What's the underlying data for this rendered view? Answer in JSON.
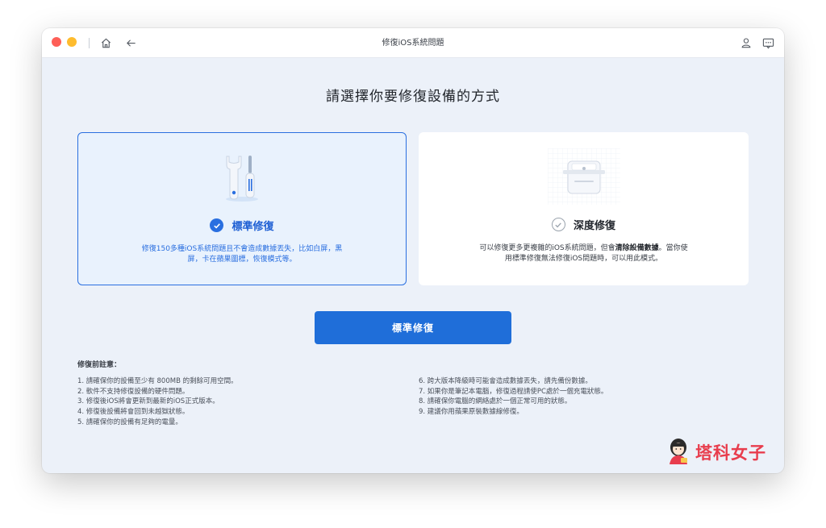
{
  "window": {
    "title": "修復iOS系統問題"
  },
  "heading": "請選擇你要修復設備的方式",
  "cards": {
    "standard": {
      "title": "標準修復",
      "desc_line1": "修復150多種iOS系統問題且不會造成數據丟失，比如白屏，黑",
      "desc_line2": "屏，卡在蘋果圖標，恢復模式等。",
      "selected": true
    },
    "deep": {
      "title": "深度修復",
      "desc_pre": "可以修復更多更複雜的iOS系統問題，但會",
      "desc_bold": "清除設備數據",
      "desc_post": "。當你使",
      "desc_line2": "用標準修復無法修復iOS問題時，可以用此模式。",
      "selected": false
    }
  },
  "primary_button": "標準修復",
  "notes": {
    "title": "修復前註意：",
    "left": [
      "1. 請確保你的設備至少有 800MB 的剩餘可用空間。",
      "2. 軟件不支持修復設備的硬件問題。",
      "3. 修復後iOS將會更新到最新的iOS正式版本。",
      "4. 修復後設備將會回到未越獄狀態。",
      "5. 請確保你的設備有足夠的電量。"
    ],
    "right": [
      "6. 跨大版本降級時可能會造成數據丟失，請先備份數據。",
      "7. 如果你是筆記本電腦，修復過程請使PC處於一個充電狀態。",
      "8. 請確保你電腦的網絡處於一個正常可用的狀態。",
      "9. 建議你用蘋果原裝數據線修復。"
    ]
  },
  "watermark": "塔科女子",
  "colors": {
    "accent": "#1f6ed9",
    "selected_bg": "#e9f2fd",
    "window_bg": "#ecf1f9",
    "watermark": "#e83d4d"
  },
  "icons": [
    "home-icon",
    "back-arrow-icon",
    "user-icon",
    "chat-icon",
    "wrench-screwdriver-icon",
    "device-icon",
    "check-icon"
  ]
}
